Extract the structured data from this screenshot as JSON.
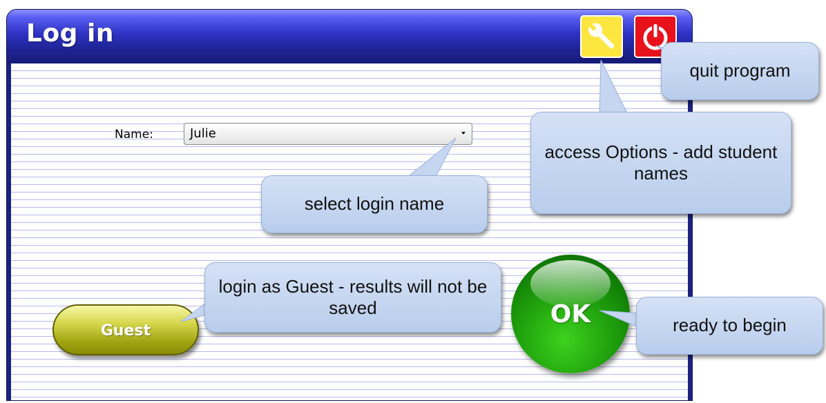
{
  "window": {
    "title": "Log in"
  },
  "toolbar": {
    "options_icon": "wrench-icon",
    "quit_icon": "power-icon",
    "options_color": "#fde640",
    "quit_color": "#e8121c"
  },
  "form": {
    "name_label": "Name:",
    "name_selected": "Julie"
  },
  "buttons": {
    "guest": "Guest",
    "ok": "OK"
  },
  "callouts": {
    "quit": "quit program",
    "options": "access Options - add student names",
    "select": "select login name",
    "guest": "login as Guest - results will not be saved",
    "ready": "ready to begin"
  },
  "colors": {
    "titlebar": "#2d32c4",
    "ok_button": "#22a40e",
    "guest_button": "#a0a410",
    "callout": "#c6d6f0"
  }
}
